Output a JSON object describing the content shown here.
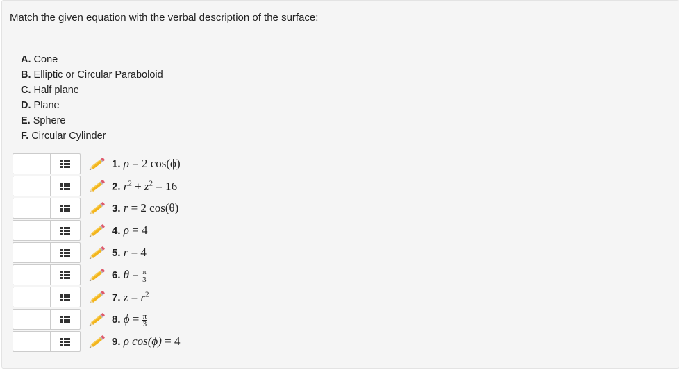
{
  "prompt": "Match the given equation with the verbal description of the surface:",
  "options": [
    {
      "letter": "A.",
      "text": "Cone"
    },
    {
      "letter": "B.",
      "text": "Elliptic or Circular Paraboloid"
    },
    {
      "letter": "C.",
      "text": "Half plane"
    },
    {
      "letter": "D.",
      "text": "Plane"
    },
    {
      "letter": "E.",
      "text": "Sphere"
    },
    {
      "letter": "F.",
      "text": "Circular Cylinder"
    }
  ],
  "items": [
    {
      "num": "1.",
      "value": "",
      "icon": "grid-icon",
      "edit_icon": "pencil-icon"
    },
    {
      "num": "2.",
      "value": "",
      "icon": "grid-icon",
      "edit_icon": "pencil-icon"
    },
    {
      "num": "3.",
      "value": "",
      "icon": "grid-icon",
      "edit_icon": "pencil-icon"
    },
    {
      "num": "4.",
      "value": "",
      "icon": "grid-icon",
      "edit_icon": "pencil-icon"
    },
    {
      "num": "5.",
      "value": "",
      "icon": "grid-icon",
      "edit_icon": "pencil-icon"
    },
    {
      "num": "6.",
      "value": "",
      "icon": "grid-icon",
      "edit_icon": "pencil-icon"
    },
    {
      "num": "7.",
      "value": "",
      "icon": "grid-icon",
      "edit_icon": "pencil-icon"
    },
    {
      "num": "8.",
      "value": "",
      "icon": "grid-icon",
      "edit_icon": "pencil-icon"
    },
    {
      "num": "9.",
      "value": "",
      "icon": "grid-icon",
      "edit_icon": "pencil-icon"
    }
  ],
  "equations": {
    "e1": {
      "lhs": "ρ",
      "op": "=",
      "rhs": "2 cos(ϕ)"
    },
    "e2": {
      "t1": "r",
      "sup1": "2",
      "plus": "+",
      "t2": "z",
      "sup2": "2",
      "op": "=",
      "rhs": "16"
    },
    "e3": {
      "lhs": "r",
      "op": "=",
      "rhs": "2 cos(θ)"
    },
    "e4": {
      "lhs": "ρ",
      "op": "=",
      "rhs": "4"
    },
    "e5": {
      "lhs": "r",
      "op": "=",
      "rhs": "4"
    },
    "e6": {
      "lhs": "θ",
      "op": "=",
      "num": "π",
      "den": "3"
    },
    "e7": {
      "lhs": "z",
      "op": "=",
      "t": "r",
      "sup": "2"
    },
    "e8": {
      "lhs": "ϕ",
      "op": "=",
      "num": "π",
      "den": "3"
    },
    "e9": {
      "lhs": "ρ cos(ϕ)",
      "op": "=",
      "rhs": "4"
    }
  },
  "colors": {
    "card_bg": "#f5f5f5",
    "pencil_body": "#f3b51c",
    "pencil_eraser": "#e05a6b"
  }
}
